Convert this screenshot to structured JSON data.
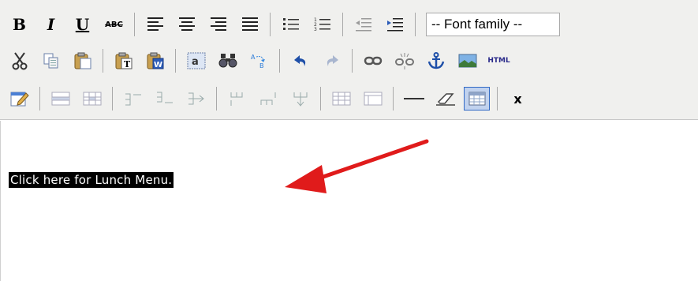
{
  "toolbar": {
    "row1": [
      {
        "label": "B",
        "icon": "bold-icon"
      },
      {
        "label": "I",
        "icon": "italic-icon"
      },
      {
        "label": "U",
        "icon": "underline-icon"
      },
      {
        "label": "ABC",
        "icon": "strikethrough-icon"
      },
      {
        "icon": "align-left-icon"
      },
      {
        "icon": "align-center-icon"
      },
      {
        "icon": "align-right-icon"
      },
      {
        "icon": "align-justify-icon"
      },
      {
        "icon": "bullet-list-icon"
      },
      {
        "icon": "numbered-list-icon"
      },
      {
        "icon": "outdent-icon"
      },
      {
        "icon": "indent-icon"
      }
    ],
    "font_family_select": "-- Font family --",
    "row2": [
      {
        "icon": "cut-icon"
      },
      {
        "icon": "copy-icon"
      },
      {
        "icon": "paste-icon"
      },
      {
        "icon": "paste-text-icon"
      },
      {
        "icon": "paste-word-icon"
      },
      {
        "icon": "select-all-icon"
      },
      {
        "icon": "find-icon"
      },
      {
        "icon": "replace-icon"
      },
      {
        "icon": "undo-icon"
      },
      {
        "icon": "redo-icon"
      },
      {
        "icon": "link-icon"
      },
      {
        "icon": "unlink-icon"
      },
      {
        "icon": "anchor-icon"
      },
      {
        "icon": "image-icon"
      },
      {
        "label": "HTML",
        "icon": "html-source-icon"
      }
    ],
    "row3": [
      {
        "icon": "edit-icon"
      },
      {
        "icon": "table-row-props-icon"
      },
      {
        "icon": "table-cell-props-icon"
      },
      {
        "icon": "insert-row-before-icon"
      },
      {
        "icon": "insert-row-after-icon"
      },
      {
        "icon": "delete-row-icon"
      },
      {
        "icon": "insert-col-before-icon"
      },
      {
        "icon": "insert-col-after-icon"
      },
      {
        "icon": "delete-col-icon"
      },
      {
        "icon": "split-cells-icon"
      },
      {
        "icon": "merge-cells-icon"
      },
      {
        "icon": "horizontal-rule-icon"
      },
      {
        "icon": "eraser-icon"
      },
      {
        "icon": "table-icon"
      },
      {
        "label": "x",
        "icon": "more-icon"
      }
    ]
  },
  "editor": {
    "selected_text": "Click here for Lunch Menu."
  },
  "colors": {
    "toolbar_bg": "#f0f0ee",
    "selection_bg": "#000000",
    "selection_fg": "#ffffff",
    "arrow": "#e01b1b",
    "active_button": "#c1d2ee"
  }
}
